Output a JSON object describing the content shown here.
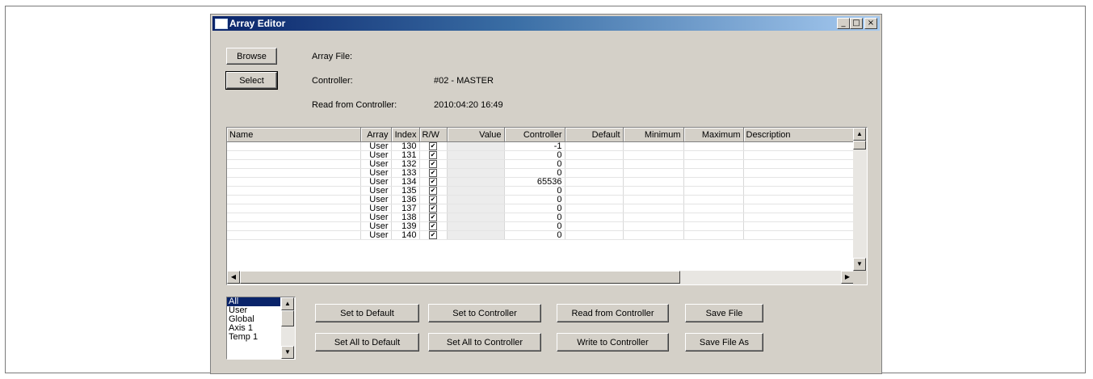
{
  "window": {
    "title": "Array Editor",
    "minimize_glyph": "_",
    "maximize_glyph": "□",
    "close_glyph": "×"
  },
  "buttons": {
    "browse": "Browse",
    "select": "Select"
  },
  "info": {
    "array_file_label": "Array File:",
    "array_file_value": "",
    "controller_label": "Controller:",
    "controller_value": "#02 - MASTER",
    "read_label": "Read from Controller:",
    "read_value": "2010:04:20 16:49"
  },
  "grid": {
    "columns": [
      "Name",
      "Array",
      "Index",
      "R/W",
      "Value",
      "Controller",
      "Default",
      "Minimum",
      "Maximum",
      "Description"
    ],
    "rows": [
      {
        "name": "",
        "array": "User",
        "index": "130",
        "rw": true,
        "value": "",
        "controller": "-1",
        "default": "",
        "minimum": "",
        "maximum": "",
        "description": ""
      },
      {
        "name": "",
        "array": "User",
        "index": "131",
        "rw": true,
        "value": "",
        "controller": "0",
        "default": "",
        "minimum": "",
        "maximum": "",
        "description": ""
      },
      {
        "name": "",
        "array": "User",
        "index": "132",
        "rw": true,
        "value": "",
        "controller": "0",
        "default": "",
        "minimum": "",
        "maximum": "",
        "description": ""
      },
      {
        "name": "",
        "array": "User",
        "index": "133",
        "rw": true,
        "value": "",
        "controller": "0",
        "default": "",
        "minimum": "",
        "maximum": "",
        "description": ""
      },
      {
        "name": "",
        "array": "User",
        "index": "134",
        "rw": true,
        "value": "",
        "controller": "65536",
        "default": "",
        "minimum": "",
        "maximum": "",
        "description": ""
      },
      {
        "name": "",
        "array": "User",
        "index": "135",
        "rw": true,
        "value": "",
        "controller": "0",
        "default": "",
        "minimum": "",
        "maximum": "",
        "description": ""
      },
      {
        "name": "",
        "array": "User",
        "index": "136",
        "rw": true,
        "value": "",
        "controller": "0",
        "default": "",
        "minimum": "",
        "maximum": "",
        "description": ""
      },
      {
        "name": "",
        "array": "User",
        "index": "137",
        "rw": true,
        "value": "",
        "controller": "0",
        "default": "",
        "minimum": "",
        "maximum": "",
        "description": ""
      },
      {
        "name": "",
        "array": "User",
        "index": "138",
        "rw": true,
        "value": "",
        "controller": "0",
        "default": "",
        "minimum": "",
        "maximum": "",
        "description": ""
      },
      {
        "name": "",
        "array": "User",
        "index": "139",
        "rw": true,
        "value": "",
        "controller": "0",
        "default": "",
        "minimum": "",
        "maximum": "",
        "description": ""
      },
      {
        "name": "",
        "array": "User",
        "index": "140",
        "rw": true,
        "value": "",
        "controller": "0",
        "default": "",
        "minimum": "",
        "maximum": "",
        "description": ""
      }
    ]
  },
  "filter_list": {
    "items": [
      "All",
      "User",
      "Global",
      "Axis 1",
      "Temp 1"
    ],
    "selected": "All"
  },
  "actions": {
    "set_to_default": "Set to Default",
    "set_all_to_default": "Set All to Default",
    "set_to_controller": "Set to Controller",
    "set_all_to_controller": "Set All to Controller",
    "read_from_controller": "Read from Controller",
    "write_to_controller": "Write to Controller",
    "save_file": "Save File",
    "save_file_as": "Save File As"
  },
  "icons": {
    "scroll_up": "▲",
    "scroll_down": "▼",
    "scroll_left": "◀",
    "scroll_right": "▶",
    "check": "✔"
  }
}
